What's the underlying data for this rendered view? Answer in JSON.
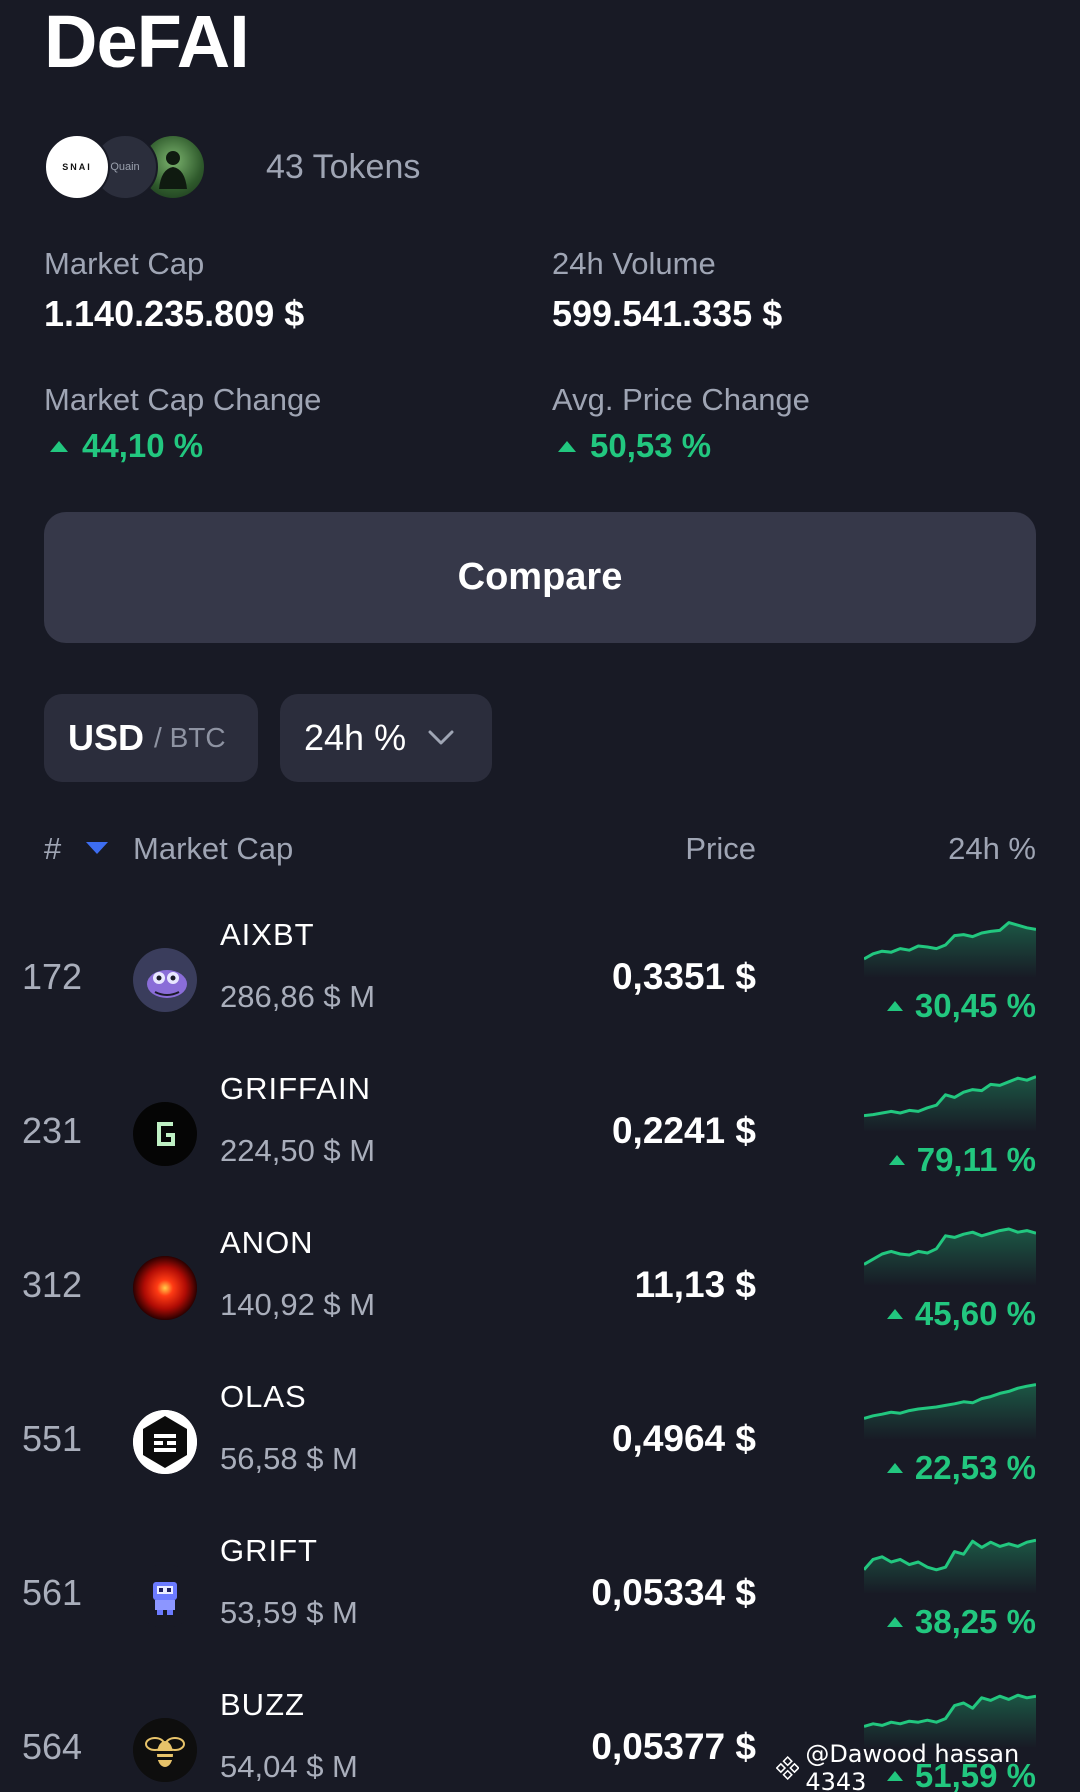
{
  "title": "DeFAI",
  "tokens": {
    "count_label": "43 Tokens",
    "avatar_texts": [
      "SNAI",
      "Quain"
    ]
  },
  "stats": {
    "market_cap_label": "Market Cap",
    "market_cap_value": "1.140.235.809 $",
    "volume_label": "24h Volume",
    "volume_value": "599.541.335 $",
    "mcap_change_label": "Market Cap Change",
    "mcap_change_value": "44,10 %",
    "avg_price_change_label": "Avg. Price Change",
    "avg_price_change_value": "50,53 %"
  },
  "compare_label": "Compare",
  "filters": {
    "currency_selected": "USD",
    "currency_alt": "/ BTC",
    "period_label": "24h %"
  },
  "table": {
    "headers": {
      "rank": "#",
      "market_cap": "Market Cap",
      "price": "Price",
      "change": "24h %"
    },
    "rows": [
      {
        "rank": "172",
        "name": "AIXBT",
        "mcap": "286,86 $ M",
        "price": "0,3351 $",
        "change": "30,45 %",
        "trend": [
          0.25,
          0.35,
          0.4,
          0.38,
          0.45,
          0.42,
          0.5,
          0.48,
          0.45,
          0.52,
          0.7,
          0.72,
          0.68,
          0.75,
          0.78,
          0.8,
          0.95,
          0.9,
          0.85,
          0.82
        ]
      },
      {
        "rank": "231",
        "name": "GRIFFAIN",
        "mcap": "224,50 $ M",
        "price": "0,2241 $",
        "change": "79,11 %",
        "trend": [
          0.2,
          0.22,
          0.25,
          0.28,
          0.25,
          0.3,
          0.28,
          0.35,
          0.4,
          0.6,
          0.55,
          0.65,
          0.7,
          0.68,
          0.8,
          0.78,
          0.85,
          0.92,
          0.88,
          0.95
        ]
      },
      {
        "rank": "312",
        "name": "ANON",
        "mcap": "140,92 $ M",
        "price": "11,13 $",
        "change": "45,60 %",
        "trend": [
          0.3,
          0.4,
          0.5,
          0.55,
          0.5,
          0.48,
          0.55,
          0.52,
          0.6,
          0.85,
          0.82,
          0.88,
          0.92,
          0.85,
          0.9,
          0.95,
          0.98,
          0.92,
          0.95,
          0.9
        ]
      },
      {
        "rank": "551",
        "name": "OLAS",
        "mcap": "56,58 $ M",
        "price": "0,4964 $",
        "change": "22,53 %",
        "trend": [
          0.3,
          0.35,
          0.38,
          0.42,
          0.4,
          0.45,
          0.48,
          0.5,
          0.52,
          0.55,
          0.58,
          0.62,
          0.6,
          0.68,
          0.72,
          0.78,
          0.82,
          0.88,
          0.92,
          0.95
        ]
      },
      {
        "rank": "561",
        "name": "GRIFT",
        "mcap": "53,59 $ M",
        "price": "0,05334 $",
        "change": "38,25 %",
        "trend": [
          0.35,
          0.55,
          0.6,
          0.5,
          0.55,
          0.45,
          0.5,
          0.4,
          0.35,
          0.4,
          0.7,
          0.65,
          0.9,
          0.78,
          0.88,
          0.8,
          0.85,
          0.8,
          0.88,
          0.92
        ]
      },
      {
        "rank": "564",
        "name": "BUZZ",
        "mcap": "54,04 $ M",
        "price": "0,05377 $",
        "change": "51,59 %",
        "trend": [
          0.3,
          0.35,
          0.32,
          0.38,
          0.35,
          0.4,
          0.38,
          0.42,
          0.38,
          0.45,
          0.7,
          0.75,
          0.65,
          0.85,
          0.8,
          0.88,
          0.82,
          0.9,
          0.85,
          0.88
        ]
      }
    ]
  },
  "watermark": "@Dawood hassan 4343",
  "colors": {
    "background": "#181a25",
    "positive": "#22c77f",
    "sort_arrow": "#3d6df0",
    "button": "#363849"
  },
  "icons": {
    "sort": "triangle-down-icon",
    "dropdown": "chevron-down-icon",
    "change_up": "triangle-up-icon",
    "watermark": "binance-logo-icon"
  }
}
